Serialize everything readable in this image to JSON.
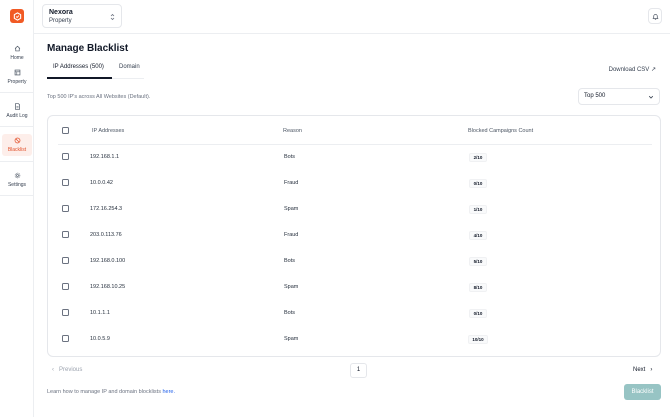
{
  "sidebar": {
    "items": [
      {
        "label": "Home",
        "icon": "home-icon"
      },
      {
        "label": "Property",
        "icon": "property-icon"
      },
      {
        "label": "Audit Log",
        "icon": "audit-log-icon"
      },
      {
        "label": "Blacklist",
        "icon": "blacklist-icon",
        "active": true
      },
      {
        "label": "Settings",
        "icon": "settings-icon"
      }
    ]
  },
  "header": {
    "property_name": "Nexora",
    "property_sub": "Property"
  },
  "page": {
    "title": "Manage Blacklist",
    "tabs": [
      {
        "label": "IP Addresses (500)",
        "active": true
      },
      {
        "label": "Domain",
        "active": false
      }
    ],
    "download_label": "Download CSV ↗",
    "caption": "Top 500 IP's across All Websites (Default).",
    "top_select": "Top 500"
  },
  "table": {
    "columns": [
      "IP Addresses",
      "Reason",
      "Blocked Campaigns Count"
    ],
    "rows": [
      {
        "ip": "192.168.1.1",
        "reason": "Bots",
        "count": "2/10"
      },
      {
        "ip": "10.0.0.42",
        "reason": "Fraud",
        "count": "0/10"
      },
      {
        "ip": "172.16.254.3",
        "reason": "Spam",
        "count": "1/10"
      },
      {
        "ip": "203.0.113.76",
        "reason": "Fraud",
        "count": "4/10"
      },
      {
        "ip": "192.168.0.100",
        "reason": "Bots",
        "count": "5/10"
      },
      {
        "ip": "192.168.10.25",
        "reason": "Spam",
        "count": "8/10"
      },
      {
        "ip": "10.1.1.1",
        "reason": "Bots",
        "count": "0/10"
      },
      {
        "ip": "10.0.5.9",
        "reason": "Spam",
        "count": "10/10"
      }
    ]
  },
  "pagination": {
    "previous": "Previous",
    "page": "1",
    "next": "Next"
  },
  "footer": {
    "learn_text": "Learn how to manage IP and domain blocklists ",
    "learn_link": "here.",
    "blacklist_button": "Blacklist"
  },
  "colors": {
    "accent": "#f15a24",
    "button_disabled": "#97c4c4",
    "link": "#2563eb"
  }
}
